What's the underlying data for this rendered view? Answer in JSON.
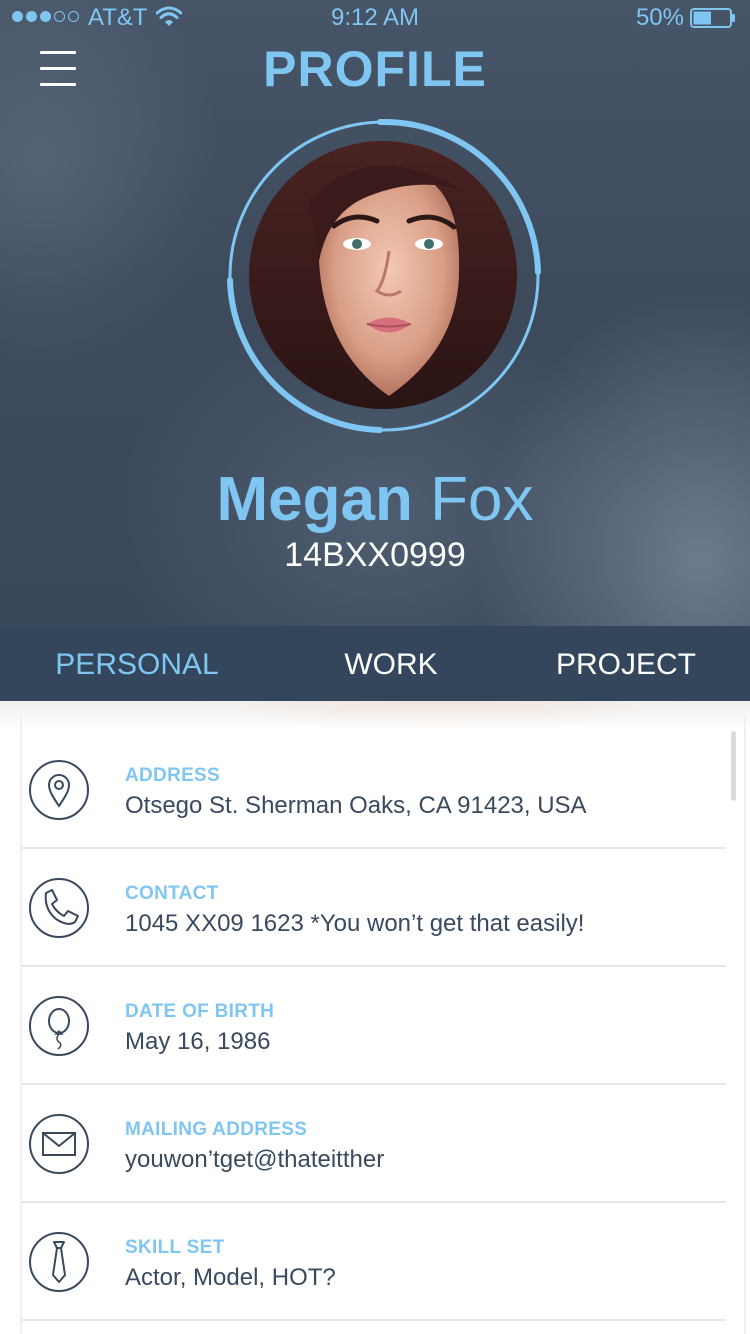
{
  "status_bar": {
    "carrier": "AT&T",
    "time": "9:12 AM",
    "battery": "50%",
    "battery_level": 0.5,
    "signal_bars_filled": 3,
    "signal_bars_total": 5
  },
  "header": {
    "title": "PROFILE",
    "menu_icon": "hamburger-menu-icon"
  },
  "profile": {
    "first_name": "Megan",
    "last_name": "Fox",
    "id": "14BXX0999"
  },
  "tabs": [
    {
      "label": "PERSONAL",
      "active": true
    },
    {
      "label": "WORK",
      "active": false
    },
    {
      "label": "PROJECT",
      "active": false
    }
  ],
  "details": [
    {
      "icon": "map-pin-icon",
      "label": "ADDRESS",
      "value": "Otsego St. Sherman Oaks, CA 91423, USA"
    },
    {
      "icon": "phone-icon",
      "label": "CONTACT",
      "value": "1045 XX09 1623  *You won’t get that easily!"
    },
    {
      "icon": "balloon-icon",
      "label": "DATE OF BIRTH",
      "value": "May 16, 1986"
    },
    {
      "icon": "envelope-icon",
      "label": "MAILING ADDRESS",
      "value": "youwon’tget@thateitther"
    },
    {
      "icon": "tie-icon",
      "label": "SKILL SET",
      "value": "Actor, Model, HOT?"
    }
  ],
  "colors": {
    "accent": "#7fc6f2",
    "header_bg": "#3d4b5d",
    "tab_bar_bg": "#34465c",
    "text_dark": "#394a5e",
    "divider": "#e4e7eb"
  }
}
